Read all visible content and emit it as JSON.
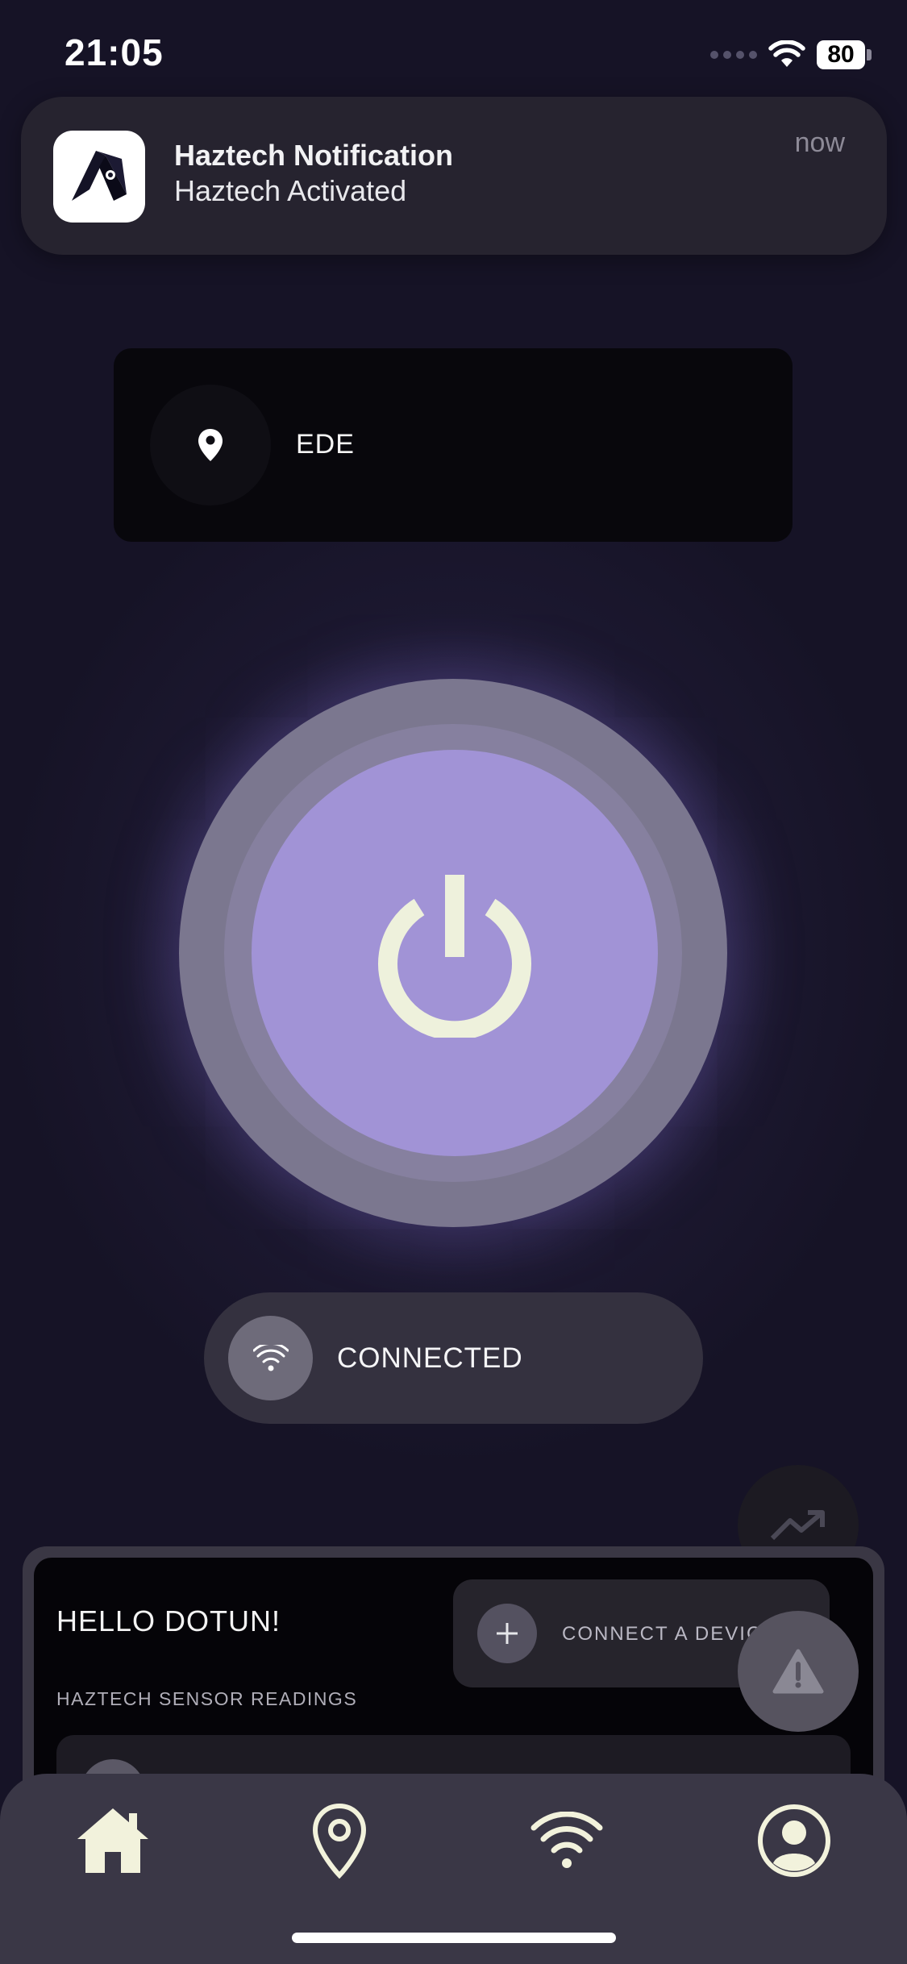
{
  "status_bar": {
    "time": "21:05",
    "battery": "80"
  },
  "notification": {
    "title": "Haztech Notification",
    "body": "Haztech Activated",
    "time": "now",
    "app_icon": "haztech-logo-icon"
  },
  "location": {
    "label": "EDE",
    "icon": "location-pin-icon"
  },
  "power": {
    "icon": "power-icon",
    "state": "on"
  },
  "connection": {
    "label": "CONNECTED",
    "icon": "wifi-icon"
  },
  "floating_actions": [
    {
      "icon": "trending-up-icon"
    },
    {
      "icon": "warning-icon"
    }
  ],
  "sheet": {
    "greeting": "HELLO DOTUN!",
    "connect_device_label": "CONNECT A DEVICE",
    "sensor_heading": "HAZTECH SENSOR READINGS"
  },
  "bottom_nav": [
    {
      "icon": "home-icon",
      "active": true
    },
    {
      "icon": "location-pin-icon"
    },
    {
      "icon": "wifi-icon"
    },
    {
      "icon": "profile-icon"
    }
  ],
  "colors": {
    "accent": "#a193d6",
    "nav_active": "#f2f2dc",
    "background": "#17142a"
  }
}
